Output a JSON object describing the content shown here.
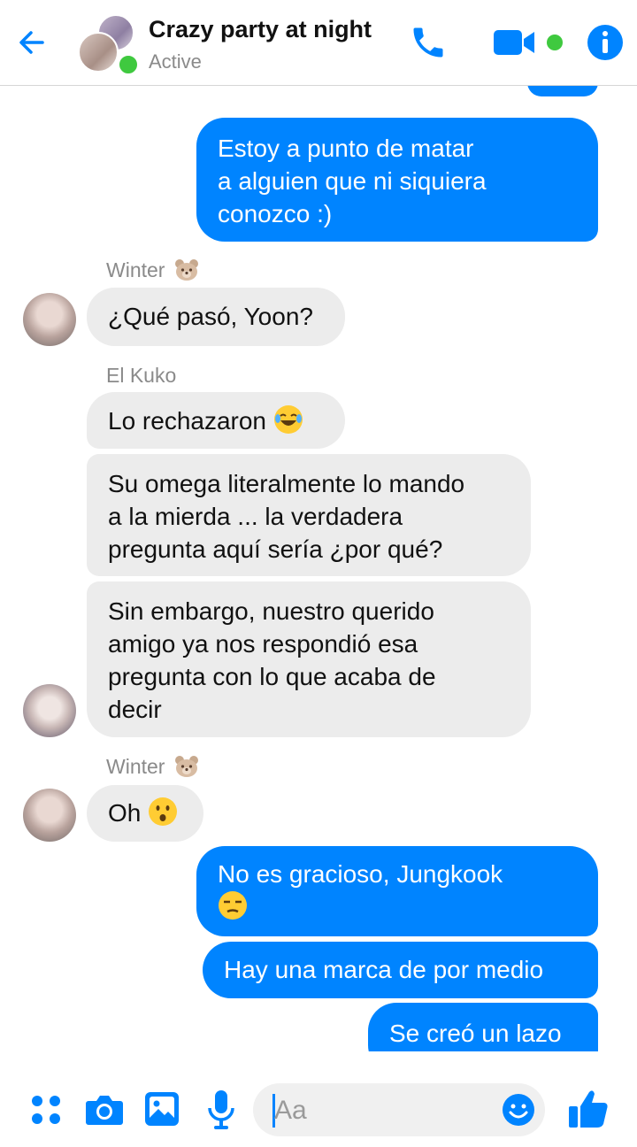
{
  "header": {
    "title": "Crazy party at night",
    "status": "Active",
    "icons": [
      "back-arrow-icon",
      "phone-icon",
      "video-camera-icon",
      "info-icon"
    ]
  },
  "messages": [
    {
      "type": "out",
      "text_lines": [
        "Estoy a punto de matar",
        "a alguien que ni siquiera",
        "conozco :)"
      ]
    },
    {
      "type": "sender",
      "name": "Winter",
      "emoji": "bear-face"
    },
    {
      "type": "in",
      "text": "¿Qué pasó, Yoon?"
    },
    {
      "type": "sender",
      "name": "El Kuko"
    },
    {
      "type": "in",
      "text": "Lo rechazaron",
      "emoji": "face-with-tears-of-joy"
    },
    {
      "type": "in",
      "text_lines": [
        "Su omega literalmente lo mando",
        "a la mierda ... la verdadera",
        "pregunta aquí sería ¿por qué?"
      ]
    },
    {
      "type": "in",
      "text_lines": [
        "Sin embargo, nuestro querido",
        "amigo ya nos respondió esa",
        "pregunta con lo que acaba de",
        "decir"
      ]
    },
    {
      "type": "sender",
      "name": "Winter",
      "emoji": "bear-face"
    },
    {
      "type": "in",
      "text": "Oh",
      "emoji": "hushed-face"
    },
    {
      "type": "out",
      "text": "No es gracioso, Jungkook",
      "emoji": "unamused-face"
    },
    {
      "type": "out",
      "text": "Hay una marca de por medio"
    },
    {
      "type": "out",
      "text": "Se creó un lazo"
    }
  ],
  "composer": {
    "placeholder": "Aa",
    "icons": [
      "apps-icon",
      "camera-icon",
      "gallery-icon",
      "microphone-icon",
      "emoji-icon",
      "thumbs-up-icon"
    ]
  },
  "colors": {
    "accent": "#0084ff",
    "incoming": "#ececec",
    "online": "#3fc93f"
  }
}
